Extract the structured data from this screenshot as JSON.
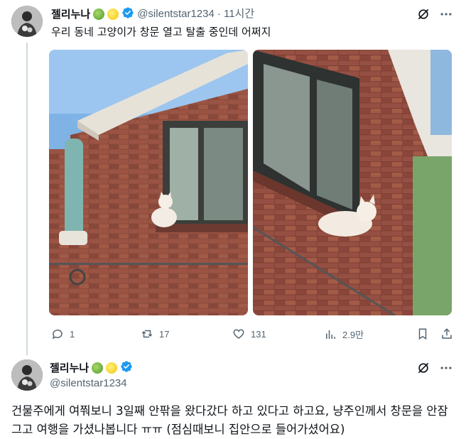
{
  "post1": {
    "author_name": "젤리누나",
    "handle": "@silentstar1234",
    "time": "· 11시간",
    "text": "우리 동네 고양이가 창문 열고 탈출 중인데 어쩌지",
    "actions": {
      "replies": "1",
      "reposts": "17",
      "likes": "131",
      "views": "2.9만"
    }
  },
  "post2": {
    "author_name": "젤리누나",
    "handle": "@silentstar1234",
    "text": "건물주에게 여쭤보니 3일째 안팎을 왔다갔다 하고 있다고 하고요, 냥주인께서 창문을 안잠그고 여행을 가셨나봅니다 ㅠㅠ (점심때보니 집안으로 들어가셨어요)"
  },
  "badge_emojis": [
    "melon-icon",
    "lemon-icon"
  ],
  "colors": {
    "verified": "#1d9bf0",
    "muted": "#536471",
    "text": "#0f1419",
    "thread_line": "#cfd9de"
  }
}
